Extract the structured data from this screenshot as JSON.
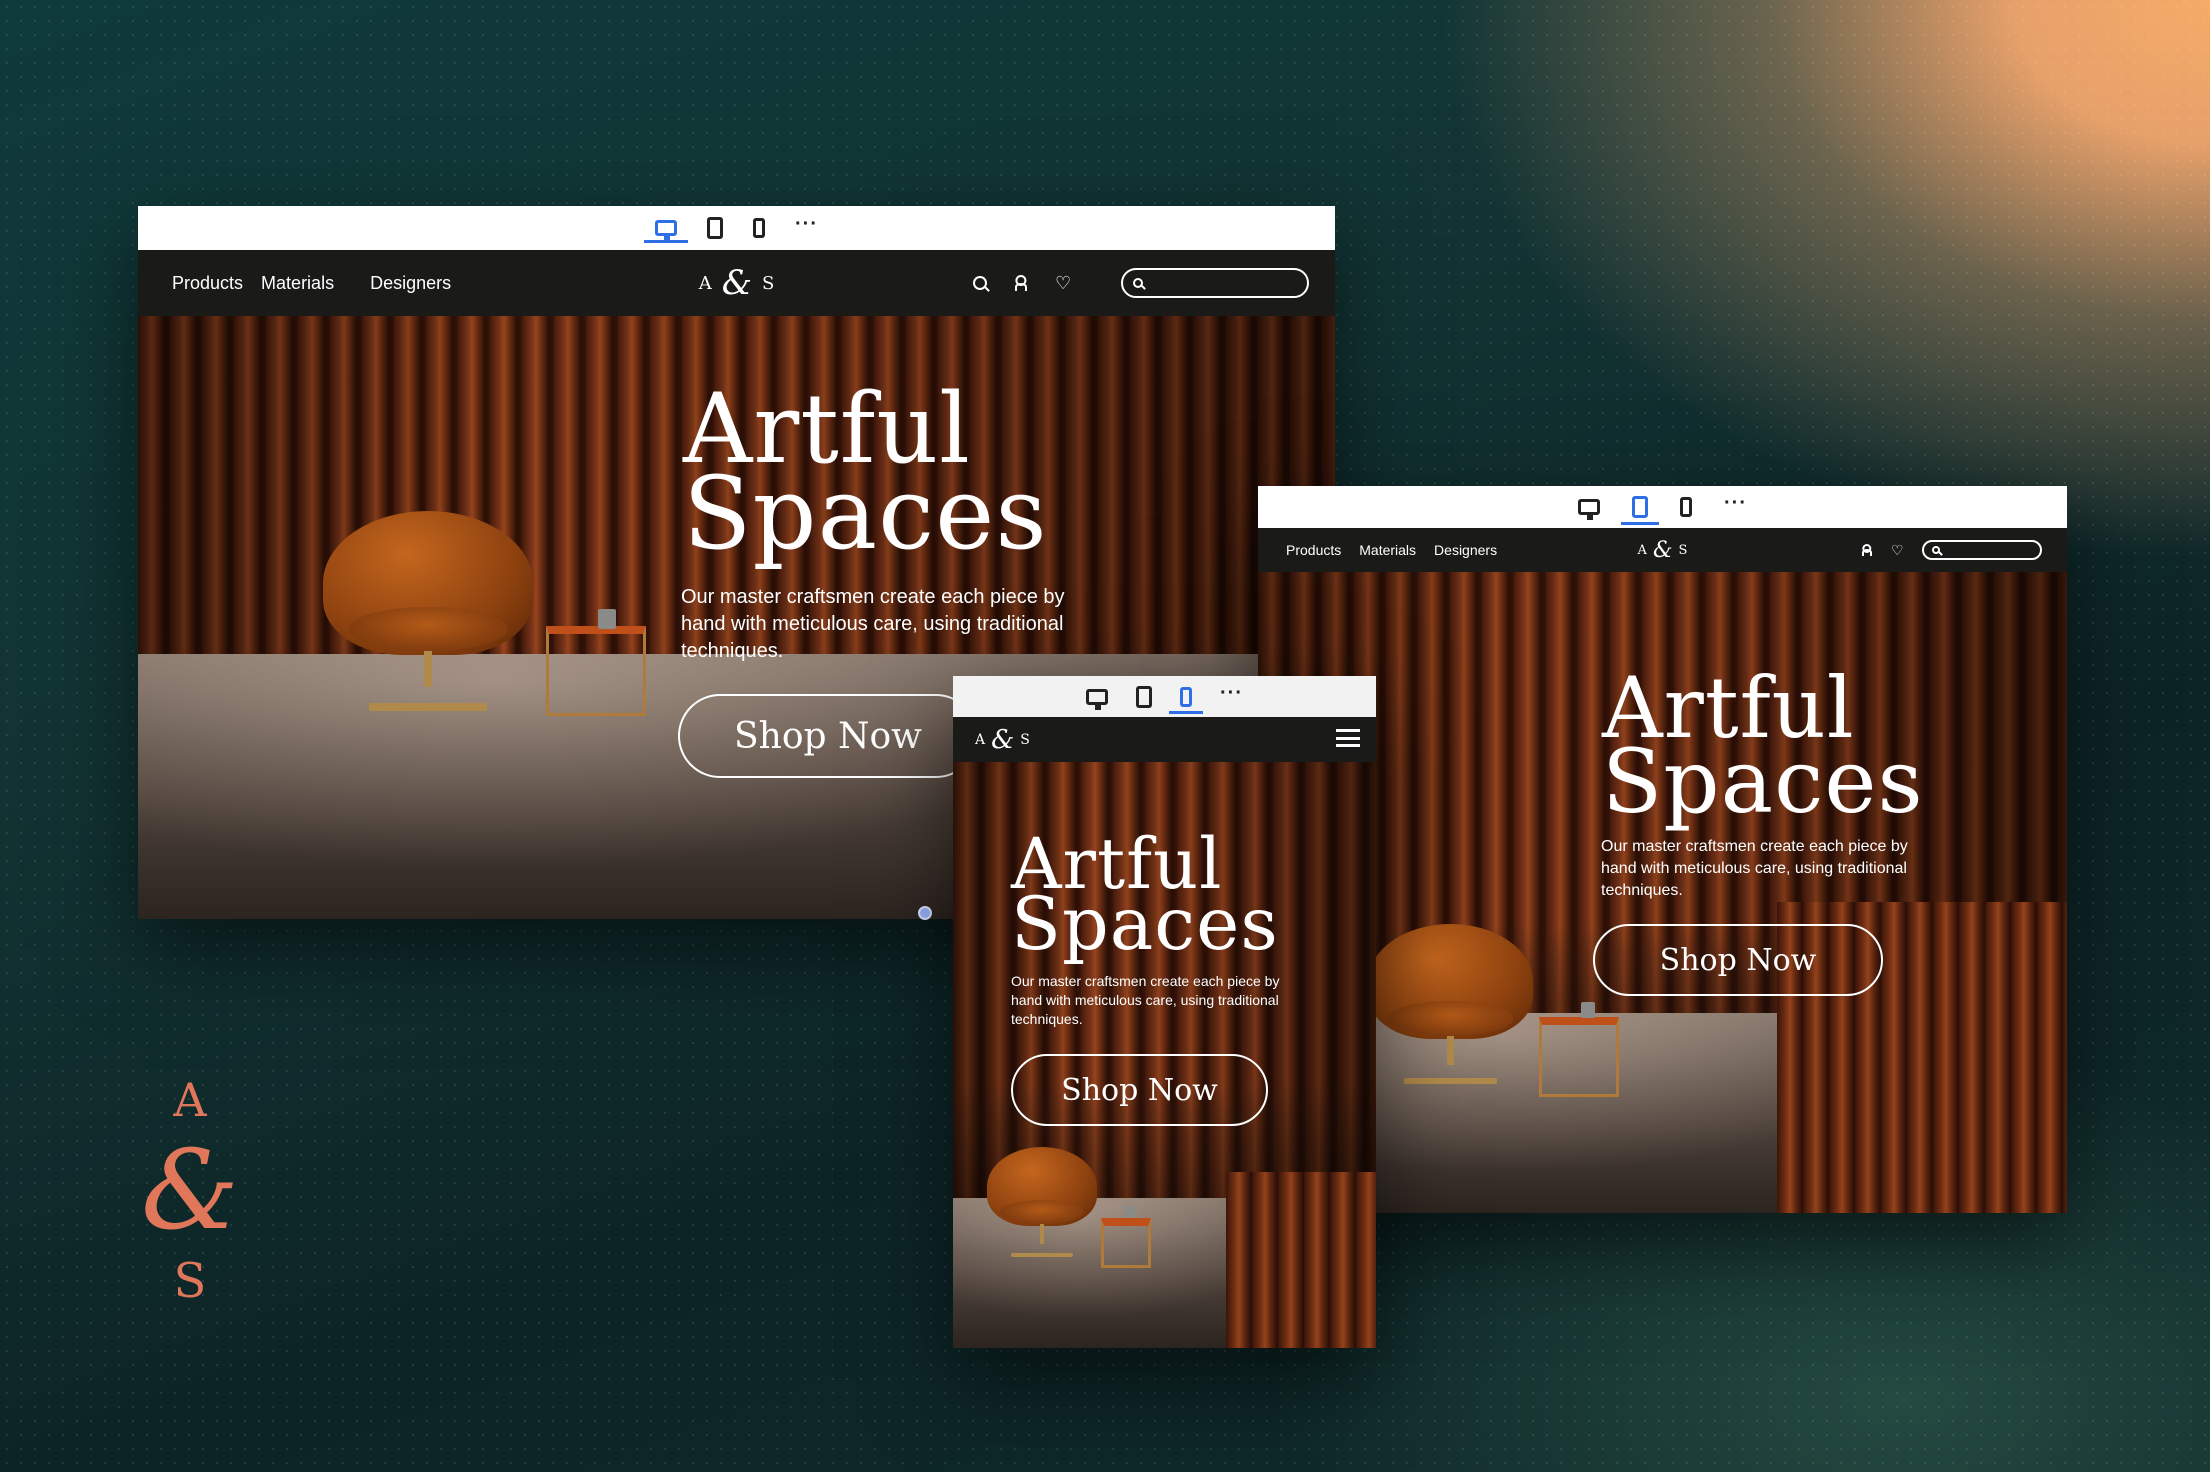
{
  "side_brand": {
    "a": "A",
    "amp": "&",
    "s": "S"
  },
  "toolbar": {
    "desktop_icon": "desktop-icon",
    "tablet_icon": "tablet-icon",
    "mobile_icon": "mobile-icon",
    "more": "···"
  },
  "nav": {
    "products": "Products",
    "materials": "Materials",
    "designers": "Designers",
    "logo_a": "A",
    "logo_amp": "&",
    "logo_s": "S"
  },
  "hero": {
    "title_line1": "Artful",
    "title_line2": "Spaces",
    "body": "Our master craftsmen create each piece by hand with meticulous care, using traditional techniques.",
    "cta": "Shop Now"
  },
  "colors": {
    "accent": "#e0765a",
    "active_device": "#2f6fe5",
    "nav_bg": "#1a1a18"
  }
}
